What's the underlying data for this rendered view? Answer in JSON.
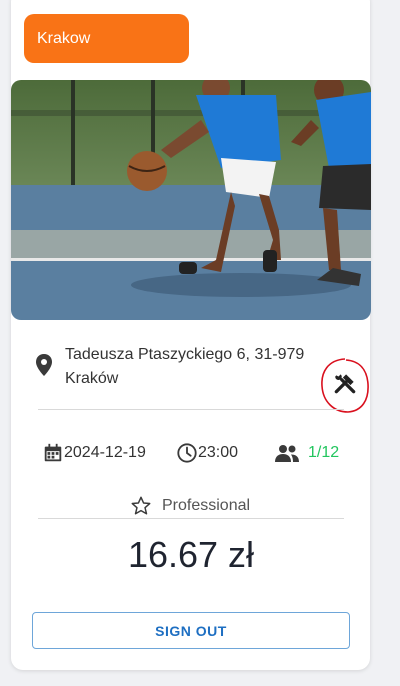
{
  "card": {
    "city": "Krakow",
    "address_line1": "Tadeusza Ptaszyckiego 6, 31-979",
    "address_line2": "Kraków",
    "date": "2024-12-19",
    "time": "23:00",
    "participants": "1/12",
    "level": "Professional",
    "price": "16.67 zł",
    "signout_label": "SIGN OUT"
  },
  "icons": [
    "location-pin-icon",
    "tools-icon",
    "calendar-icon",
    "clock-icon",
    "people-icon",
    "star-outline-icon"
  ],
  "colors": {
    "badge": "#f97316",
    "count": "#22c55e",
    "button_text": "#1e6fc2",
    "annotation": "#d9101e"
  }
}
